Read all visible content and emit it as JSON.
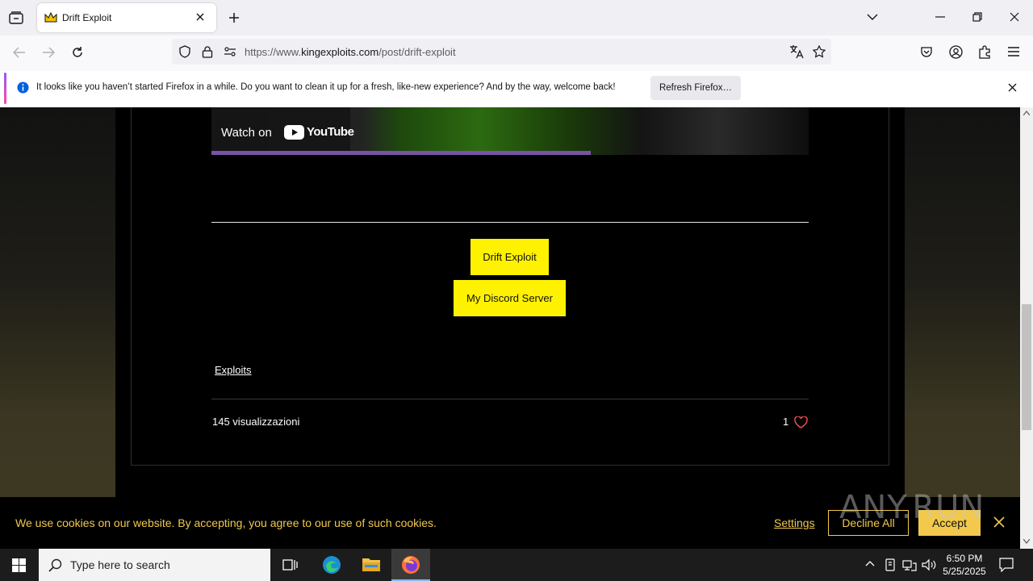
{
  "browser": {
    "tab": {
      "title": "Drift Exploit"
    },
    "url": {
      "scheme": "https://www.",
      "host": "kingexploits.com",
      "path": "/post/drift-exploit"
    },
    "notification": {
      "message": "It looks like you haven’t started Firefox in a while. Do you want to clean it up for a fresh, like-new experience? And by the way, welcome back!",
      "button": "Refresh Firefox…"
    }
  },
  "page": {
    "video": {
      "watch_on": "Watch on",
      "youtube": "YouTube"
    },
    "buttons": {
      "drift_exploit": "Drift Exploit",
      "discord": "My Discord Server"
    },
    "category_link": "Exploits",
    "views": "145 visualizzazioni",
    "likes": "1",
    "colors": {
      "button_yellow": "#fff200",
      "cookie_gold": "#f2c94c",
      "heart": "#e8504a"
    }
  },
  "cookie_banner": {
    "text": "We use cookies on our website. By accepting, you agree to our use of such cookies.",
    "settings": "Settings",
    "decline": "Decline All",
    "accept": "Accept"
  },
  "watermark": "ANY.RUN",
  "taskbar": {
    "search_placeholder": "Type here to search",
    "time": "6:50 PM",
    "date": "5/25/2025"
  }
}
